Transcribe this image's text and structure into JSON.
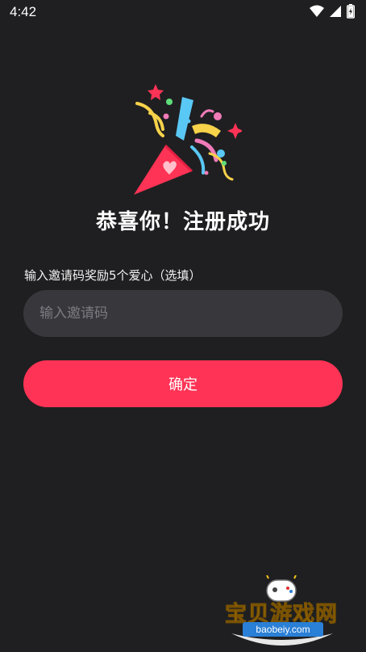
{
  "status_bar": {
    "time": "4:42",
    "icons": [
      "wifi-icon",
      "cell-signal-icon",
      "battery-charging-icon"
    ]
  },
  "illustration": {
    "name": "party-popper-icon",
    "colors": {
      "cone": "#fe3355",
      "heart": "#ffc0cc",
      "yellow": "#f7d24a",
      "blue": "#5ac8f5",
      "pink": "#f07bb8",
      "green": "#5fdc7a"
    }
  },
  "title": "恭喜你！注册成功",
  "invite": {
    "label": "输入邀请码奖励5个爱心（选填）",
    "placeholder": "输入邀请码",
    "value": ""
  },
  "confirm_button": "确定",
  "watermark": {
    "text": "宝贝游戏网",
    "url": "baobeiy.com"
  },
  "colors": {
    "background": "#1f1f21",
    "input_bg": "#38383c",
    "accent": "#fe3355"
  }
}
